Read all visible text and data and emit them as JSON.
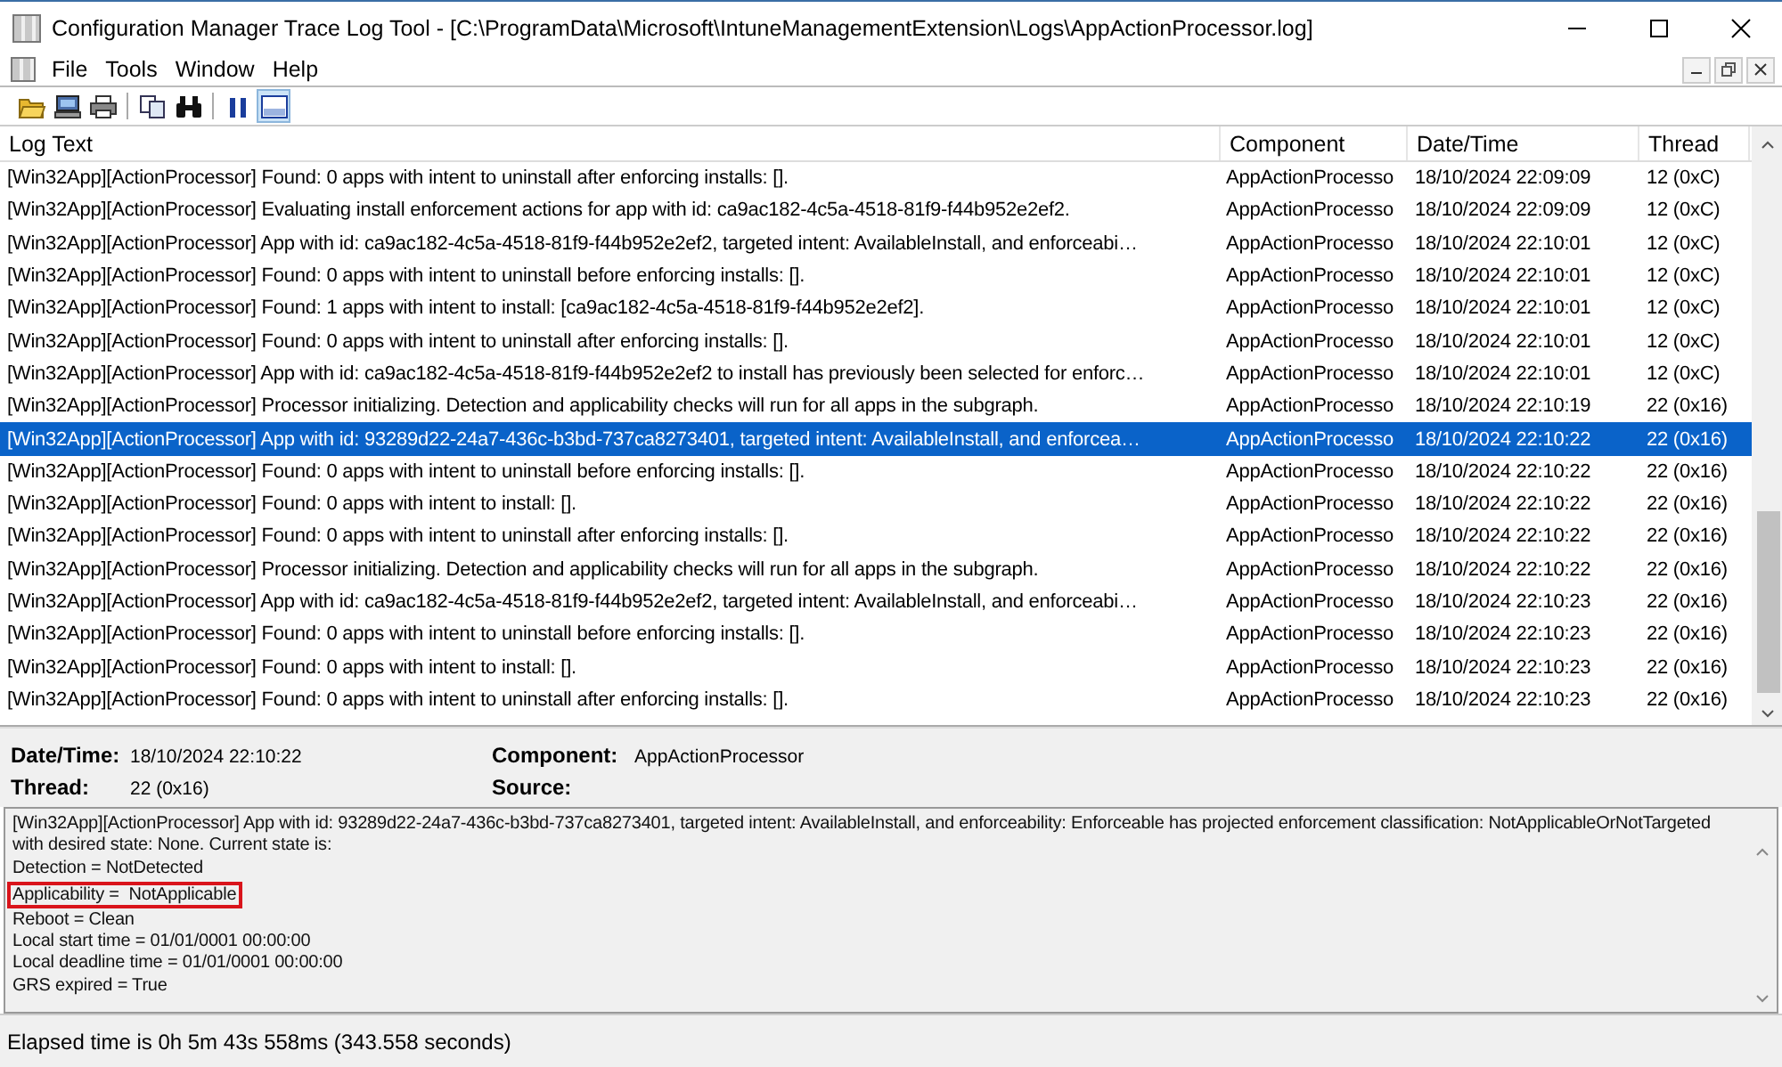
{
  "window": {
    "title": "Configuration Manager Trace Log Tool - [C:\\ProgramData\\Microsoft\\IntuneManagementExtension\\Logs\\AppActionProcessor.log]"
  },
  "menu": [
    "File",
    "Tools",
    "Window",
    "Help"
  ],
  "toolbar": [
    {
      "kind": "open",
      "pressed": false
    },
    {
      "kind": "computer",
      "pressed": false
    },
    {
      "kind": "print",
      "pressed": false
    },
    {
      "kind": "sep"
    },
    {
      "kind": "copy",
      "pressed": false
    },
    {
      "kind": "find",
      "pressed": false
    },
    {
      "kind": "sep"
    },
    {
      "kind": "pause",
      "pressed": false
    },
    {
      "kind": "pane",
      "pressed": true
    }
  ],
  "table": {
    "columns": [
      "Log Text",
      "Component",
      "Date/Time",
      "Thread"
    ],
    "rows": [
      {
        "cells": [
          "[Win32App][ActionProcessor] Found: 0 apps with intent to uninstall after enforcing installs: [].",
          "AppActionProcesso",
          "18/10/2024 22:09:09",
          "12 (0xC)"
        ],
        "selected": false
      },
      {
        "cells": [
          "[Win32App][ActionProcessor] Evaluating install enforcement actions for app with id: ca9ac182-4c5a-4518-81f9-f44b952e2ef2.",
          "AppActionProcesso",
          "18/10/2024 22:09:09",
          "12 (0xC)"
        ],
        "selected": false
      },
      {
        "cells": [
          "[Win32App][ActionProcessor] App with id: ca9ac182-4c5a-4518-81f9-f44b952e2ef2, targeted intent: AvailableInstall, and enforceabi…",
          "AppActionProcesso",
          "18/10/2024 22:10:01",
          "12 (0xC)"
        ],
        "selected": false
      },
      {
        "cells": [
          "[Win32App][ActionProcessor] Found: 0 apps with intent to uninstall before enforcing installs: [].",
          "AppActionProcesso",
          "18/10/2024 22:10:01",
          "12 (0xC)"
        ],
        "selected": false
      },
      {
        "cells": [
          "[Win32App][ActionProcessor] Found: 1 apps with intent to install: [ca9ac182-4c5a-4518-81f9-f44b952e2ef2].",
          "AppActionProcesso",
          "18/10/2024 22:10:01",
          "12 (0xC)"
        ],
        "selected": false
      },
      {
        "cells": [
          "[Win32App][ActionProcessor] Found: 0 apps with intent to uninstall after enforcing installs: [].",
          "AppActionProcesso",
          "18/10/2024 22:10:01",
          "12 (0xC)"
        ],
        "selected": false
      },
      {
        "cells": [
          "[Win32App][ActionProcessor] App with id: ca9ac182-4c5a-4518-81f9-f44b952e2ef2 to install has previously been selected for enforc…",
          "AppActionProcesso",
          "18/10/2024 22:10:01",
          "12 (0xC)"
        ],
        "selected": false
      },
      {
        "cells": [
          "[Win32App][ActionProcessor] Processor initializing. Detection and applicability checks will run for all apps in the subgraph.",
          "AppActionProcesso",
          "18/10/2024 22:10:19",
          "22 (0x16)"
        ],
        "selected": false
      },
      {
        "cells": [
          "[Win32App][ActionProcessor] App with id: 93289d22-24a7-436c-b3bd-737ca8273401, targeted intent: AvailableInstall, and enforcea…",
          "AppActionProcesso",
          "18/10/2024 22:10:22",
          "22 (0x16)"
        ],
        "selected": true
      },
      {
        "cells": [
          "[Win32App][ActionProcessor] Found: 0 apps with intent to uninstall before enforcing installs: [].",
          "AppActionProcesso",
          "18/10/2024 22:10:22",
          "22 (0x16)"
        ],
        "selected": false
      },
      {
        "cells": [
          "[Win32App][ActionProcessor] Found: 0 apps with intent to install: [].",
          "AppActionProcesso",
          "18/10/2024 22:10:22",
          "22 (0x16)"
        ],
        "selected": false
      },
      {
        "cells": [
          "[Win32App][ActionProcessor] Found: 0 apps with intent to uninstall after enforcing installs: [].",
          "AppActionProcesso",
          "18/10/2024 22:10:22",
          "22 (0x16)"
        ],
        "selected": false
      },
      {
        "cells": [
          "[Win32App][ActionProcessor] Processor initializing. Detection and applicability checks will run for all apps in the subgraph.",
          "AppActionProcesso",
          "18/10/2024 22:10:22",
          "22 (0x16)"
        ],
        "selected": false
      },
      {
        "cells": [
          "[Win32App][ActionProcessor] App with id: ca9ac182-4c5a-4518-81f9-f44b952e2ef2, targeted intent: AvailableInstall, and enforceabi…",
          "AppActionProcesso",
          "18/10/2024 22:10:23",
          "22 (0x16)"
        ],
        "selected": false
      },
      {
        "cells": [
          "[Win32App][ActionProcessor] Found: 0 apps with intent to uninstall before enforcing installs: [].",
          "AppActionProcesso",
          "18/10/2024 22:10:23",
          "22 (0x16)"
        ],
        "selected": false
      },
      {
        "cells": [
          "[Win32App][ActionProcessor] Found: 0 apps with intent to install: [].",
          "AppActionProcesso",
          "18/10/2024 22:10:23",
          "22 (0x16)"
        ],
        "selected": false
      },
      {
        "cells": [
          "[Win32App][ActionProcessor] Found: 0 apps with intent to uninstall after enforcing installs: [].",
          "AppActionProcesso",
          "18/10/2024 22:10:23",
          "22 (0x16)"
        ],
        "selected": false
      }
    ]
  },
  "details": {
    "fields": [
      {
        "label": "Date/Time:",
        "value": "18/10/2024 22:10:22"
      },
      {
        "label": "Component:",
        "value": "AppActionProcessor"
      },
      {
        "label": "Thread:",
        "value": "22 (0x16)"
      },
      {
        "label": "Source:"
      }
    ],
    "lines": [
      {
        "text": "[Win32App][ActionProcessor] App with id: 93289d22-24a7-436c-b3bd-737ca8273401, targeted intent: AvailableInstall, and enforceability: Enforceable has projected enforcement classification: NotApplicableOrNotTargeted with desired state: None. Current state is:",
        "highlighted": false
      },
      {
        "text": "Detection = NotDetected",
        "highlighted": false
      },
      {
        "text": "Applicability =  NotApplicable",
        "highlighted": true
      },
      {
        "text": "Reboot = Clean",
        "highlighted": false
      },
      {
        "text": "Local start time = 01/01/0001 00:00:00",
        "highlighted": false
      },
      {
        "text": "Local deadline time = 01/01/0001 00:00:00",
        "highlighted": false
      },
      {
        "text": "GRS expired = True",
        "highlighted": false
      }
    ]
  },
  "status_bar": "Elapsed time is 0h 5m 43s 558ms (343.558 seconds)"
}
